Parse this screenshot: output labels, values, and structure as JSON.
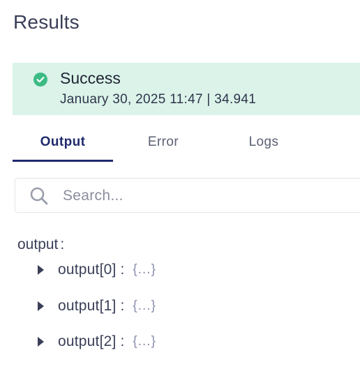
{
  "header": {
    "title": "Results"
  },
  "status": {
    "label": "Success",
    "meta": "January 30, 2025 11:47 | 34.941",
    "icon": "check-circle-icon",
    "color": "#3dbb85",
    "background": "#dbf3e9"
  },
  "tabs": [
    {
      "label": "Output",
      "active": true
    },
    {
      "label": "Error",
      "active": false
    },
    {
      "label": "Logs",
      "active": false
    }
  ],
  "search": {
    "placeholder": "Search...",
    "value": ""
  },
  "tree": {
    "root_label": "output",
    "root_colon": ":",
    "nodes": [
      {
        "key": "output[0]",
        "colon": ":",
        "preview": "{...}"
      },
      {
        "key": "output[1]",
        "colon": ":",
        "preview": "{...}"
      },
      {
        "key": "output[2]",
        "colon": ":",
        "preview": "{...}"
      }
    ]
  },
  "colors": {
    "accent": "#1f2a6b",
    "success": "#3dbb85"
  }
}
